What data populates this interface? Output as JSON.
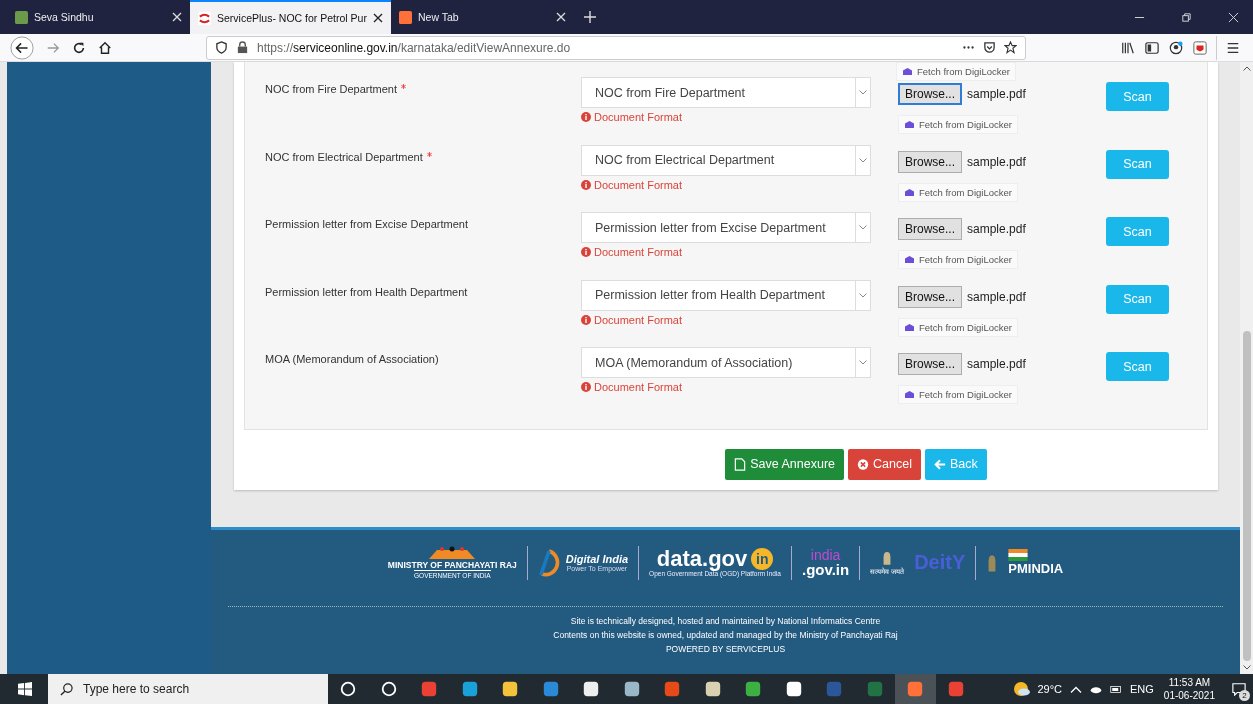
{
  "browser": {
    "tabs": [
      {
        "title": "Seva Sindhu",
        "selected": false
      },
      {
        "title": "ServicePlus- NOC for Petrol Pur",
        "selected": true
      },
      {
        "title": "New Tab",
        "selected": false
      }
    ],
    "url": {
      "scheme": "https://",
      "host": "serviceonline.gov.in",
      "path": "/karnataka/editViewAnnexure.do"
    }
  },
  "annexure": {
    "top_fetch": "Fetch from DigiLocker",
    "rows": [
      {
        "label": "NOC from Fire Department",
        "required": true,
        "document": "NOC from Fire Department",
        "format": "Document Format",
        "browse": "Browse...",
        "file": "sample.pdf",
        "browse_focused": true,
        "fetch": "Fetch from DigiLocker",
        "scan": "Scan"
      },
      {
        "label": "NOC from Electrical Department",
        "required": true,
        "document": "NOC from Electrical Department",
        "format": "Document Format",
        "browse": "Browse...",
        "file": "sample.pdf",
        "browse_focused": false,
        "fetch": "Fetch from DigiLocker",
        "scan": "Scan"
      },
      {
        "label": "Permission letter from Excise Department",
        "required": false,
        "document": "Permission letter from Excise Department",
        "format": "Document Format",
        "browse": "Browse...",
        "file": "sample.pdf",
        "browse_focused": false,
        "fetch": "Fetch from DigiLocker",
        "scan": "Scan"
      },
      {
        "label": "Permission letter from Health Department",
        "required": false,
        "document": "Permission letter from Health Department",
        "format": "Document Format",
        "browse": "Browse...",
        "file": "sample.pdf",
        "browse_focused": false,
        "fetch": "Fetch from DigiLocker",
        "scan": "Scan"
      },
      {
        "label": "MOA (Memorandum of Association)",
        "required": false,
        "document": "MOA (Memorandum of Association)",
        "format": "Document Format",
        "browse": "Browse...",
        "file": "sample.pdf",
        "browse_focused": false,
        "fetch": "Fetch from DigiLocker",
        "scan": "Scan"
      }
    ],
    "actions": [
      {
        "kind": "save",
        "label": "Save Annexure"
      },
      {
        "kind": "cancel",
        "label": "Cancel"
      },
      {
        "kind": "back",
        "label": "Back"
      }
    ]
  },
  "footer": {
    "logos": {
      "ministry": "MINISTRY OF PANCHAYATI RAJ",
      "ministry_sub": "GOVERNMENT OF INDIA",
      "digital": "Digital India",
      "digital_sub": "Power To Empower",
      "datagov": "data.gov",
      "datagov_in": "in",
      "datagov_sub": "Open Government Data (OGD) Platform India",
      "india": "india",
      ".gov": ".gov.in",
      "emblem_motto": "सत्यमेव जयते",
      "deity": "DeitY",
      "pmindia": "PMINDIA"
    },
    "lines": [
      "Site is technically designed, hosted and maintained by National Informatics Centre",
      "Contents on this website is owned, updated and managed by the Ministry of Panchayati Raj",
      "POWERED BY SERVICEPLUS"
    ]
  },
  "taskbar": {
    "search_placeholder": "Type here to search",
    "apps": [
      {
        "selected": false
      },
      {
        "selected": false
      },
      {
        "selected": false
      },
      {
        "selected": false
      },
      {
        "selected": false
      },
      {
        "selected": false
      },
      {
        "selected": false
      },
      {
        "selected": false
      },
      {
        "selected": false
      },
      {
        "selected": false
      },
      {
        "selected": false
      },
      {
        "selected": false
      },
      {
        "selected": false
      },
      {
        "selected": false
      },
      {
        "selected": true
      },
      {
        "selected": false
      }
    ],
    "temperature": "29°C",
    "language": "ENG",
    "time": "11:53 AM",
    "date": "01-06-2021",
    "notifications": "2"
  }
}
